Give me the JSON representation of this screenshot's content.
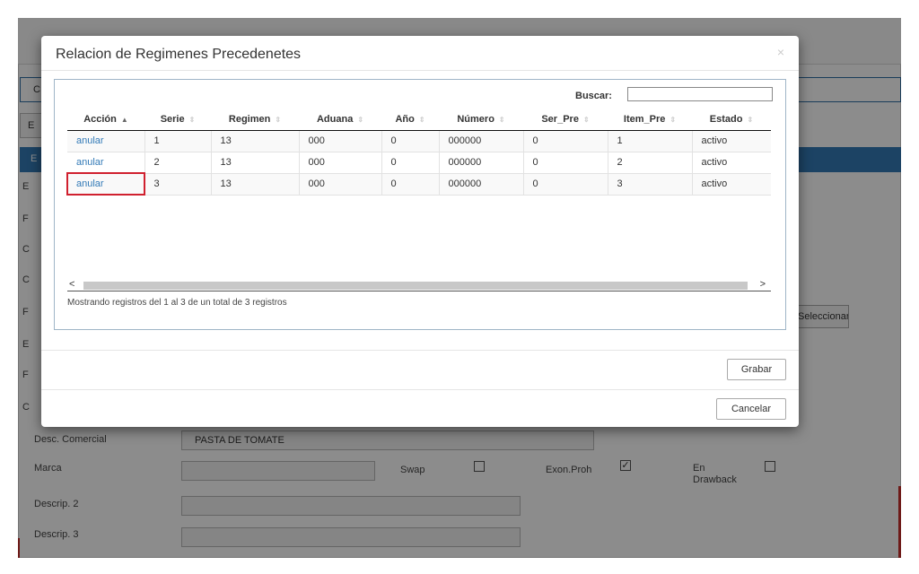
{
  "background": {
    "bar_letter": "C",
    "btn_letter": "E",
    "blue_letter": "E",
    "side_letters": [
      "E",
      "F",
      "C",
      "C",
      "F",
      "E",
      "F",
      "C"
    ],
    "right_button_label": "Seleccionar",
    "fields": {
      "desc_comercial_label": "Desc. Comercial",
      "desc_comercial_value": "PASTA DE TOMATE",
      "marca_label": "Marca",
      "swap_label": "Swap",
      "exon_label": "Exon.Proh",
      "drawback_label": "En Drawback",
      "descrip2_label": "Descrip. 2",
      "descrip3_label": "Descrip. 3"
    }
  },
  "modal": {
    "title": "Relacion de Regimenes Precedenetes",
    "close": "×",
    "search_label": "Buscar:",
    "search_value": "",
    "columns": [
      "Acción",
      "Serie",
      "Regimen",
      "Aduana",
      "Año",
      "Número",
      "Ser_Pre",
      "Item_Pre",
      "Estado"
    ],
    "rows": [
      [
        "anular",
        "1",
        "13",
        "000",
        "0",
        "000000",
        "0",
        "1",
        "activo"
      ],
      [
        "anular",
        "2",
        "13",
        "000",
        "0",
        "000000",
        "0",
        "2",
        "activo"
      ],
      [
        "anular",
        "3",
        "13",
        "000",
        "0",
        "000000",
        "0",
        "3",
        "activo"
      ]
    ],
    "scroll_left": "<",
    "scroll_right": ">",
    "info": "Mostrando registros del 1 al 3 de un total de 3 registros",
    "save_label": "Grabar",
    "cancel_label": "Cancelar"
  },
  "colors": {
    "accent": "#337ab7",
    "highlight": "#d0202f"
  }
}
